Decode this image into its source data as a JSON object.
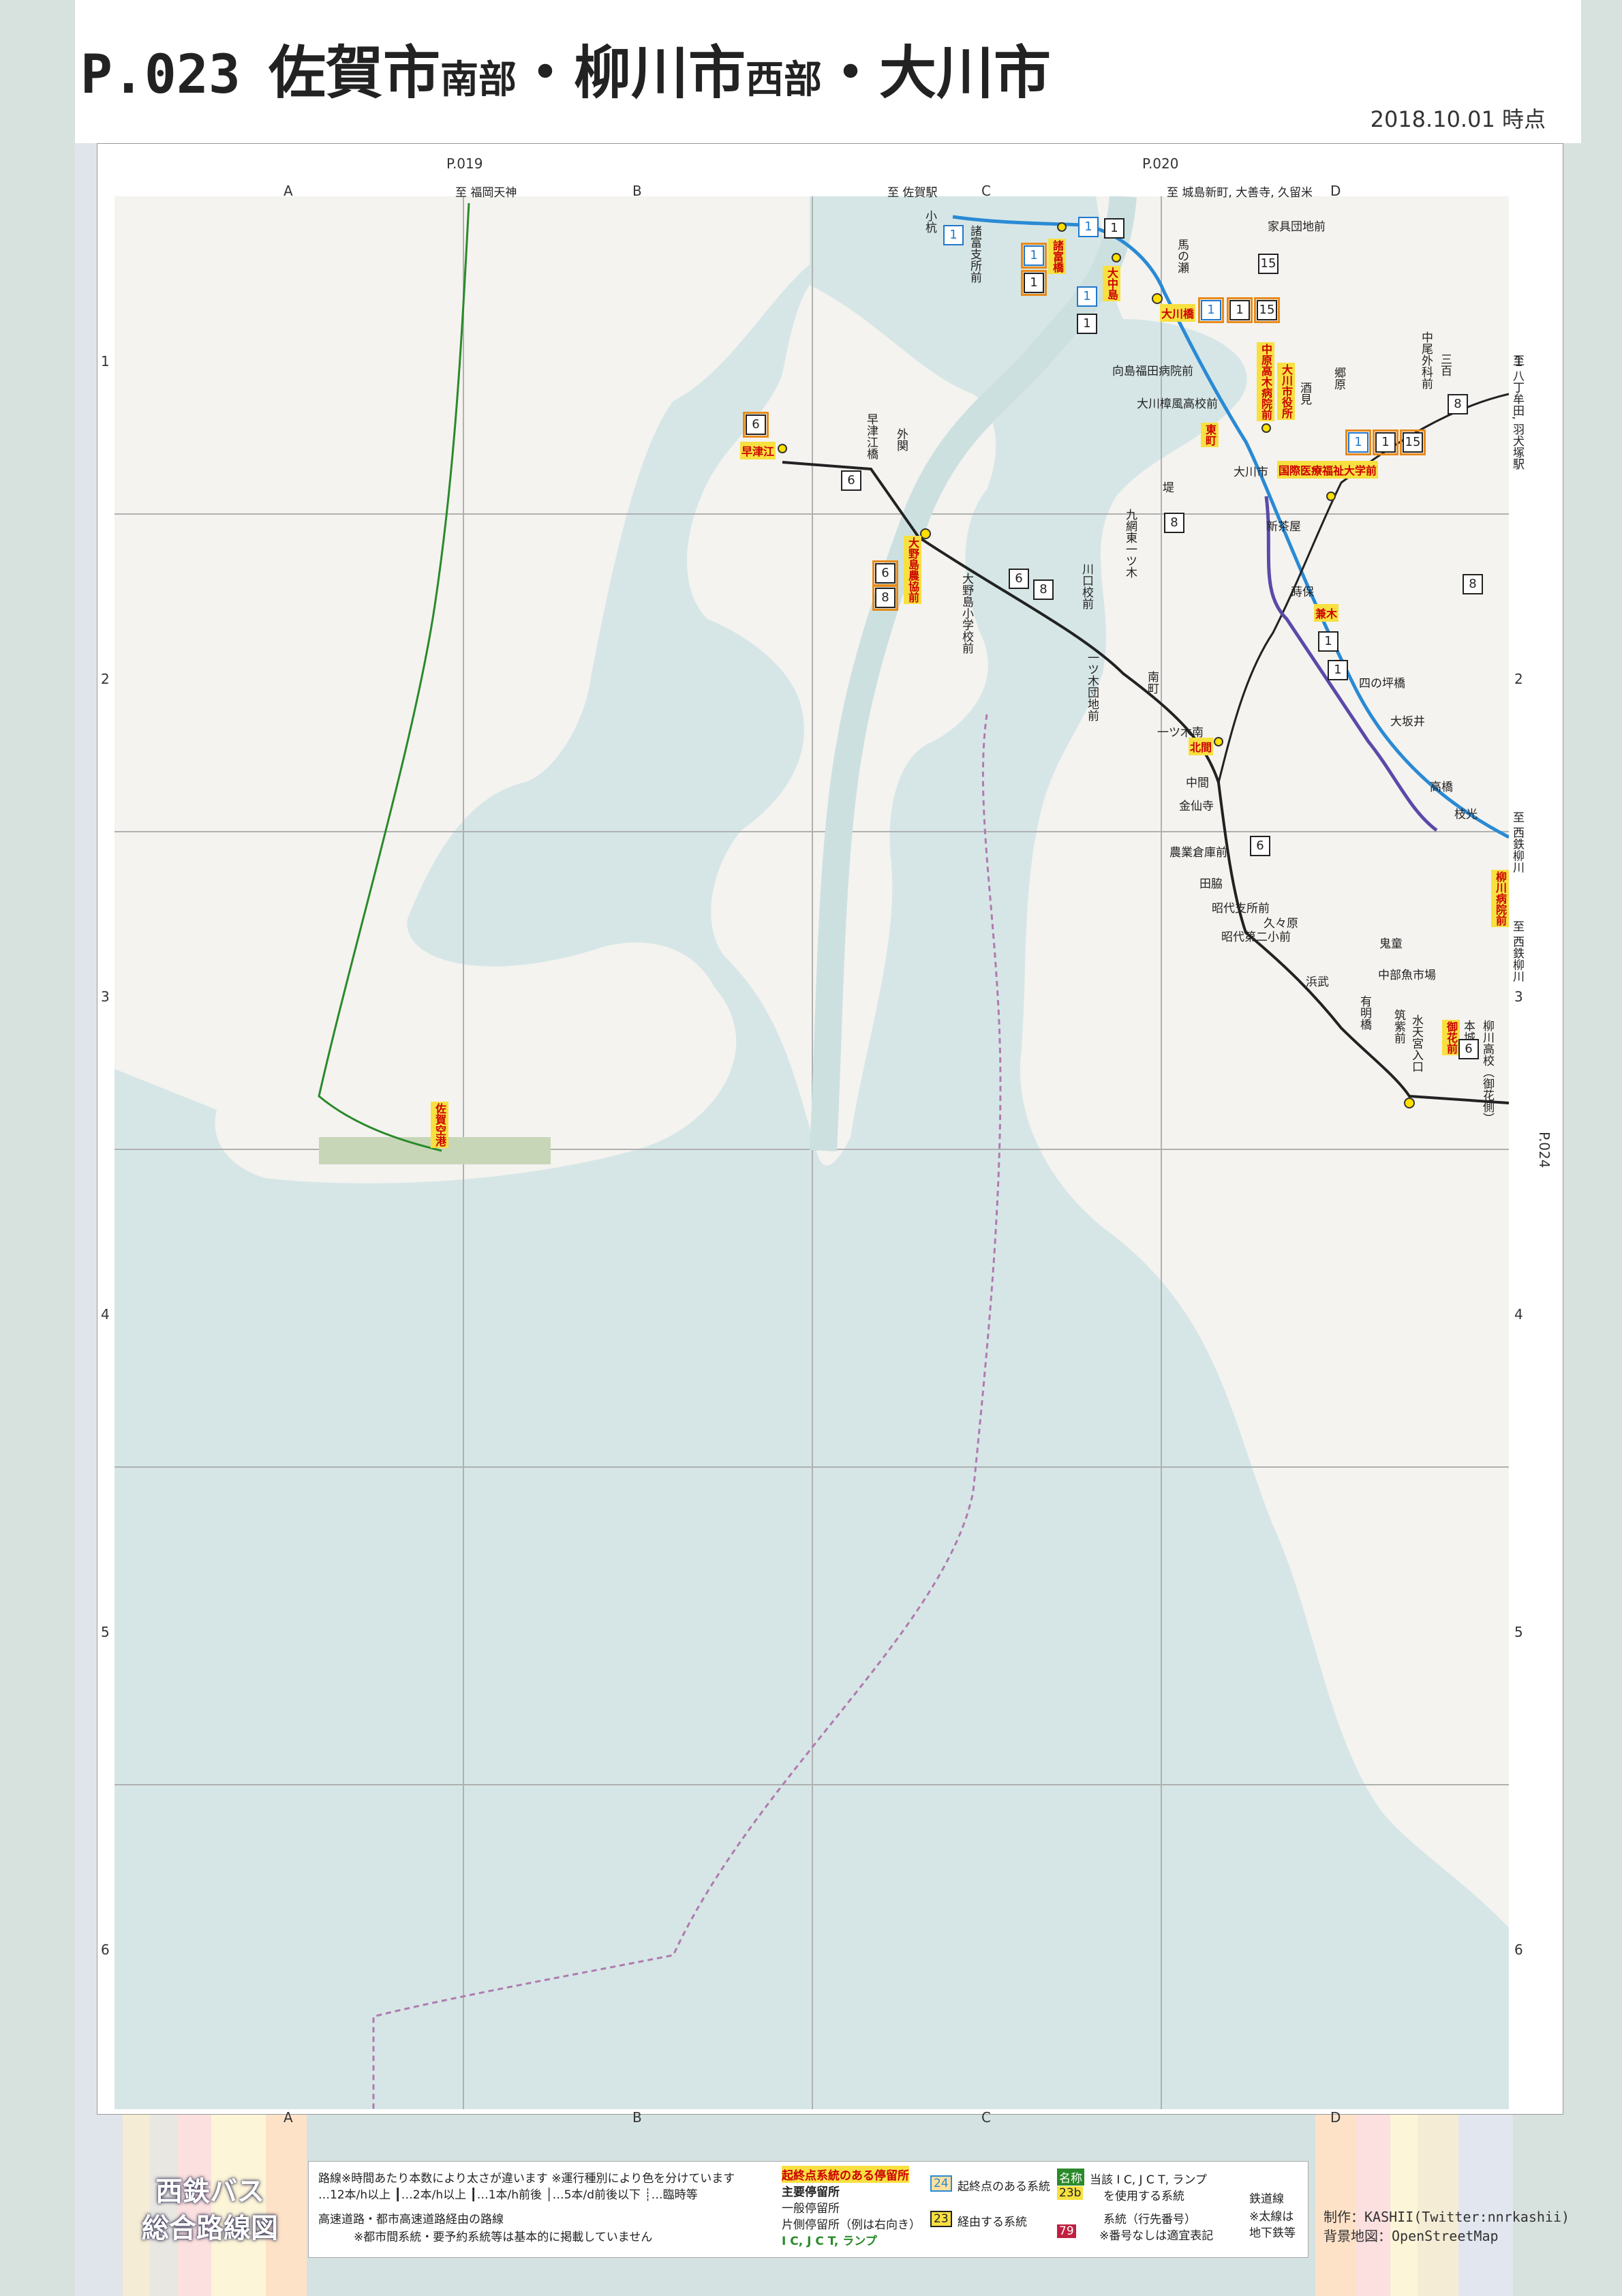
{
  "header": {
    "code": "P.023",
    "title_parts": [
      {
        "text": "佐賀市",
        "size": "big"
      },
      {
        "text": "南部",
        "size": "sm"
      },
      {
        "text": "・",
        "size": "big"
      },
      {
        "text": "柳川市",
        "size": "big"
      },
      {
        "text": "西部",
        "size": "sm"
      },
      {
        "text": "・",
        "size": "big"
      },
      {
        "text": "大川市",
        "size": "big"
      }
    ],
    "date": "2018.10.01 時点"
  },
  "neighbors": {
    "top_left": "P.019",
    "top_right": "P.020",
    "right": "P.024"
  },
  "columns": [
    "A",
    "B",
    "C",
    "D"
  ],
  "rows": [
    "1",
    "2",
    "3",
    "4",
    "5",
    "6"
  ],
  "edge_destinations": {
    "fukuoka": "至 福岡天神",
    "saga": "至 佐賀駅",
    "kashima": "至 城島新町, 大善寺, 久留米",
    "hatchome": "至 八丁牟田, 羽犬塚駅",
    "nishitetsu1": "至 西鉄柳川",
    "nishitetsu2": "至 西鉄柳川"
  },
  "stops": {
    "kogi": "小杭",
    "morotomi": "諸富支所前",
    "morotomibashi": "諸富橋",
    "onakajima": "大中島",
    "okawabashi": "大川橋",
    "umanoseki": "馬の瀬",
    "iebashi": "家具団地前",
    "mukoshima": "向島福田病院前",
    "okawa_hs": "大川樟風高校前",
    "nakaharatakagi": "中原高木病院前",
    "okawa_city": "大川市役所",
    "kokusai": "国際医療福祉大学前",
    "higashimachi": "東町",
    "sakaimachi": "酒見",
    "gobara": "郷原",
    "nakao": "中尾外科前",
    "sanban": "三百",
    "okawashi": "大川市",
    "hayatsue": "早津江",
    "hayatsue_bashi": "早津江橋",
    "tozeki": "外関",
    "onoshima": "大野島農協前",
    "onoshima_es": "大野島小学校前",
    "kawaguchi": "川口校前",
    "kutsurahigashi": "九網東一ツ木",
    "hitotsugi_danchi": "一ツ木団地前",
    "saki": "堤",
    "shinchaya": "新茶屋",
    "ebisu": "蒔保",
    "kaneki": "兼木",
    "shinoharabashi": "四の坪橋",
    "osakai": "大坂井",
    "takahashi": "高橋",
    "tomimitsu": "枝光",
    "minamimachi": "南町",
    "hitotsugiminami": "一ツ木南",
    "kitase": "北間",
    "nakama": "中間",
    "kinsenji": "金仙寺",
    "nogyo": "農業倉庫前",
    "tawaki": "田脇",
    "showa_shisho": "昭代支所前",
    "kubohara": "久々原",
    "showa_2sho": "昭代第二小前",
    "hamatake": "浜武",
    "arima": "有明橋",
    "chikushi": "筑紫前",
    "suiten": "水天宮入口",
    "chubu": "中部魚市場",
    "oninou": "鬼童",
    "motojo": "本城町",
    "ohanamae": "御花前",
    "yanagawa_hosp": "柳川病院前",
    "yanagawa_hs": "柳川高校（御花側）",
    "saga_airport": "佐賀空港"
  },
  "routes": {
    "r1": "1",
    "r6": "6",
    "r8": "8",
    "r15": "15"
  },
  "legend": {
    "line_title": "路線※時間あたり本数により太さが違います ※運行種別により色を分けています",
    "line_sub": "…12本/h以上 ┃…2本/h以上 ┃…1本/h前後 │…5本/d前後以下 ┊…臨時等",
    "highway": "高速道路・都市高速道路経由の路線",
    "highway_sub": "※都市間系統・要予約系統等は基本的に掲載していません",
    "stop_terminal": "起終点系統のある停留所",
    "stop_main": "主要停留所",
    "stop_general": "一般停留所",
    "stop_oneside": "片側停留所（例は右向き）",
    "stop_ic": "I C, J C T, ランプ",
    "route_start": "起終点のある系統",
    "route_via": "経由する系統",
    "ic_title": "当該 I C, J C T, ランプ",
    "ic_sub": "を使用する系統",
    "system_note": "系統（行先番号）",
    "system_sub": "※番号なしは適宜表記",
    "rail": "鉄道線",
    "rail_sub": "※太線は",
    "rail_sub2": "地下鉄等",
    "num_24": "24",
    "num_23": "23",
    "num_79": "79",
    "name_tag": "名称",
    "num_23b": "23b"
  },
  "logo": [
    "西鉄バス",
    "総合路線図"
  ],
  "credit": [
    "制作：KASHII(Twitter:nnrkashii)",
    "背景地図：OpenStreetMap"
  ],
  "colors": {
    "sea": "#d6e6e6",
    "land": "#f4f3f0",
    "blue_route": "#2a8ad4",
    "black_route": "#222222",
    "purple_route": "#5a4aa8",
    "green_route": "#2a8a2a",
    "grid": "#b0b0b0"
  }
}
